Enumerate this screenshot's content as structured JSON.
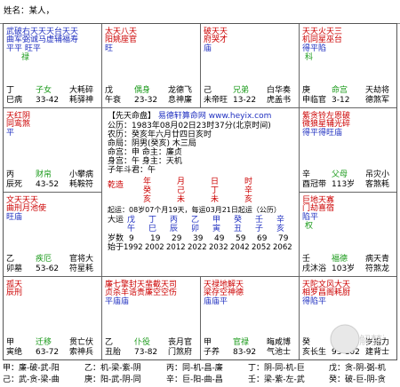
{
  "header": {
    "name_label": "姓名：某人，"
  },
  "palaces": [
    {
      "id": "si",
      "stars": "武破右天天天台天天",
      "stars2": "曲军弼诚马虚辅福寿",
      "line3": "平平 旺平",
      "hua": "禄",
      "stem": "丁",
      "branch": "巳",
      "state": "病",
      "gong": "子女",
      "age": "33-42",
      "god1": "大耗",
      "god2": "耗驿",
      "god3": "碎",
      "god4": "神"
    },
    {
      "id": "wu",
      "stars": "太天八天",
      "stars2": "阳姚座官",
      "line3": "旺",
      "stem": "戊",
      "branch": "午",
      "state": "衰",
      "gong": "偶身",
      "age": "23-32",
      "god1": "龙德",
      "god2": "息神",
      "god3": "飞",
      "god4": "廉"
    },
    {
      "id": "wei",
      "stars": "破天天",
      "stars2": "府哭才",
      "line3": "庙",
      "stem": "己",
      "branch": "未",
      "state": "帝旺",
      "gong": "兄弟",
      "age": "13-22",
      "god1": "白华",
      "god2": "虎盖",
      "god3": "奏",
      "god4": "书"
    },
    {
      "id": "shen",
      "stars": "天天火天三",
      "stars2": "机同星巫台",
      "line3": "得平陷",
      "hua": "科",
      "stem": "庚",
      "branch": "申",
      "state": "临官",
      "gong": "命宫",
      "age": "3-12",
      "god1": "天劫",
      "god2": "德煞",
      "god3": "将",
      "god4": "军"
    },
    {
      "id": "chen",
      "stars": "天红阴",
      "stars2": "同鸾煞",
      "line3": "平",
      "stem": "丙",
      "branch": "辰",
      "state": "死",
      "gong": "财帛",
      "age": "43-52",
      "god1": "小攀",
      "god2": "耗鞍",
      "god3": "病",
      "god4": "符"
    },
    {
      "id": "you",
      "stars": "紫贪铃左恩破",
      "stars2": "微狼星辅光碎",
      "line3": "得平得旺庙",
      "stem": "辛",
      "branch": "酉",
      "state": "冠带",
      "gong": "父母",
      "age": "113岁",
      "god1": "吊灾",
      "god2": "客煞",
      "god3": "小",
      "god4": "耗"
    },
    {
      "id": "mao",
      "stars": "文天天天",
      "stars2": "曲刑月池使",
      "line3": "旺庙",
      "stem": "乙",
      "branch": "卯",
      "state": "墓",
      "gong": "疾厄",
      "age": "53-62",
      "god1": "官将",
      "god2": "符星",
      "god3": "大",
      "god4": "耗"
    },
    {
      "id": "xu",
      "stars": "巨地天寡",
      "stars2": "门劫喜宿",
      "line3": "陷平",
      "hua": "权",
      "stem": "壬",
      "branch": "戌",
      "state": "沐浴",
      "gong": "福德",
      "age": "103岁",
      "god1": "病天",
      "god2": "符煞",
      "god3": "青",
      "god4": "龙"
    },
    {
      "id": "yin",
      "stars": "孤天",
      "stars2": "辰刑",
      "line3": "",
      "stem": "甲",
      "branch": "寅",
      "state": "绝",
      "gong": "迁移",
      "age": "63-72",
      "god1": "贯亡",
      "god2": "索神",
      "god3": "伏",
      "god4": "兵"
    },
    {
      "id": "chou",
      "stars": "廉七擎封天蜚截天司",
      "stars2": "贞杀羊诰贵廉空空伤",
      "line3": "平庙庙",
      "stem": "乙",
      "branch": "丑",
      "state": "胎",
      "gong": "仆役",
      "age": "73-82",
      "god1": "丧月",
      "god2": "门煞",
      "god3": "官",
      "god4": "府"
    },
    {
      "id": "zi",
      "stars": "天禄地解天",
      "stars2": "梁存空神德",
      "line3": "庙庙平",
      "stem": "甲",
      "branch": "子",
      "state": "养",
      "gong": "官禄",
      "age": "83-92",
      "god1": "晦咸",
      "god2": "气池",
      "god3": "博",
      "god4": "士"
    },
    {
      "id": "hai",
      "stars": "天陀文风大天",
      "stars2": "相罗昌阁耗厨",
      "line3": "得陷平",
      "stem": "癸",
      "branch": "亥",
      "state": "长生",
      "gong": "田宅",
      "age": "93-102",
      "god1": "岁指",
      "god2": "建背",
      "god3": "力",
      "god4": "士"
    }
  ],
  "center": {
    "title": "【先天命盘】",
    "site": "易德轩算命网",
    "url": "www.heyix.com",
    "line1": "公历：1983年08月02日23时37分(北京时间)",
    "line2": "农历：癸亥年六月廿四日亥时",
    "line3": "命局：阴男(癸亥)  木三局",
    "line4": "命宫：申    命主：廉贞",
    "line5": "身宫：午    身主：天机",
    "line6": "子年斗君：午",
    "pillar_labels": [
      "乾造",
      "年",
      "月",
      "日",
      "时"
    ],
    "stems": [
      "癸",
      "己",
      "丁",
      "辛"
    ],
    "branches": [
      "亥",
      "未",
      "未",
      "亥"
    ],
    "dayun_note": "起运：08岁07个月19天，每运03月21日起运（公历）",
    "dayun_label": "大运",
    "dayun_stems": [
      "戊",
      "丁",
      "丙",
      "乙",
      "甲",
      "癸",
      "壬",
      "辛"
    ],
    "dayun_branches": [
      "午",
      "巳",
      "辰",
      "卯",
      "寅",
      "丑",
      "子",
      "亥"
    ],
    "ages_label": "岁数",
    "ages": [
      "9",
      "19",
      "29",
      "39",
      "49",
      "59",
      "69",
      "79"
    ],
    "years_label": "始于",
    "years": [
      "1992",
      "2002",
      "2012",
      "2022",
      "2032",
      "2042",
      "2052",
      "2062"
    ]
  },
  "footer": {
    "row1": [
      "甲：廉-破-武-阳",
      "乙：机-梁-紫-阴",
      "丙：同-机-昌-廉",
      "丁：阴-同-机-巨",
      "戊：贪-阴-弼-机"
    ],
    "row2": [
      "己：武-贪-梁-曲",
      "庚：阳-武-阴-同",
      "辛：巨-阳-曲-昌",
      "壬：梁-紫-左-武",
      "癸：破-巨-阴-贪"
    ]
  },
  "watermark": {
    "text": "解梦猪"
  }
}
